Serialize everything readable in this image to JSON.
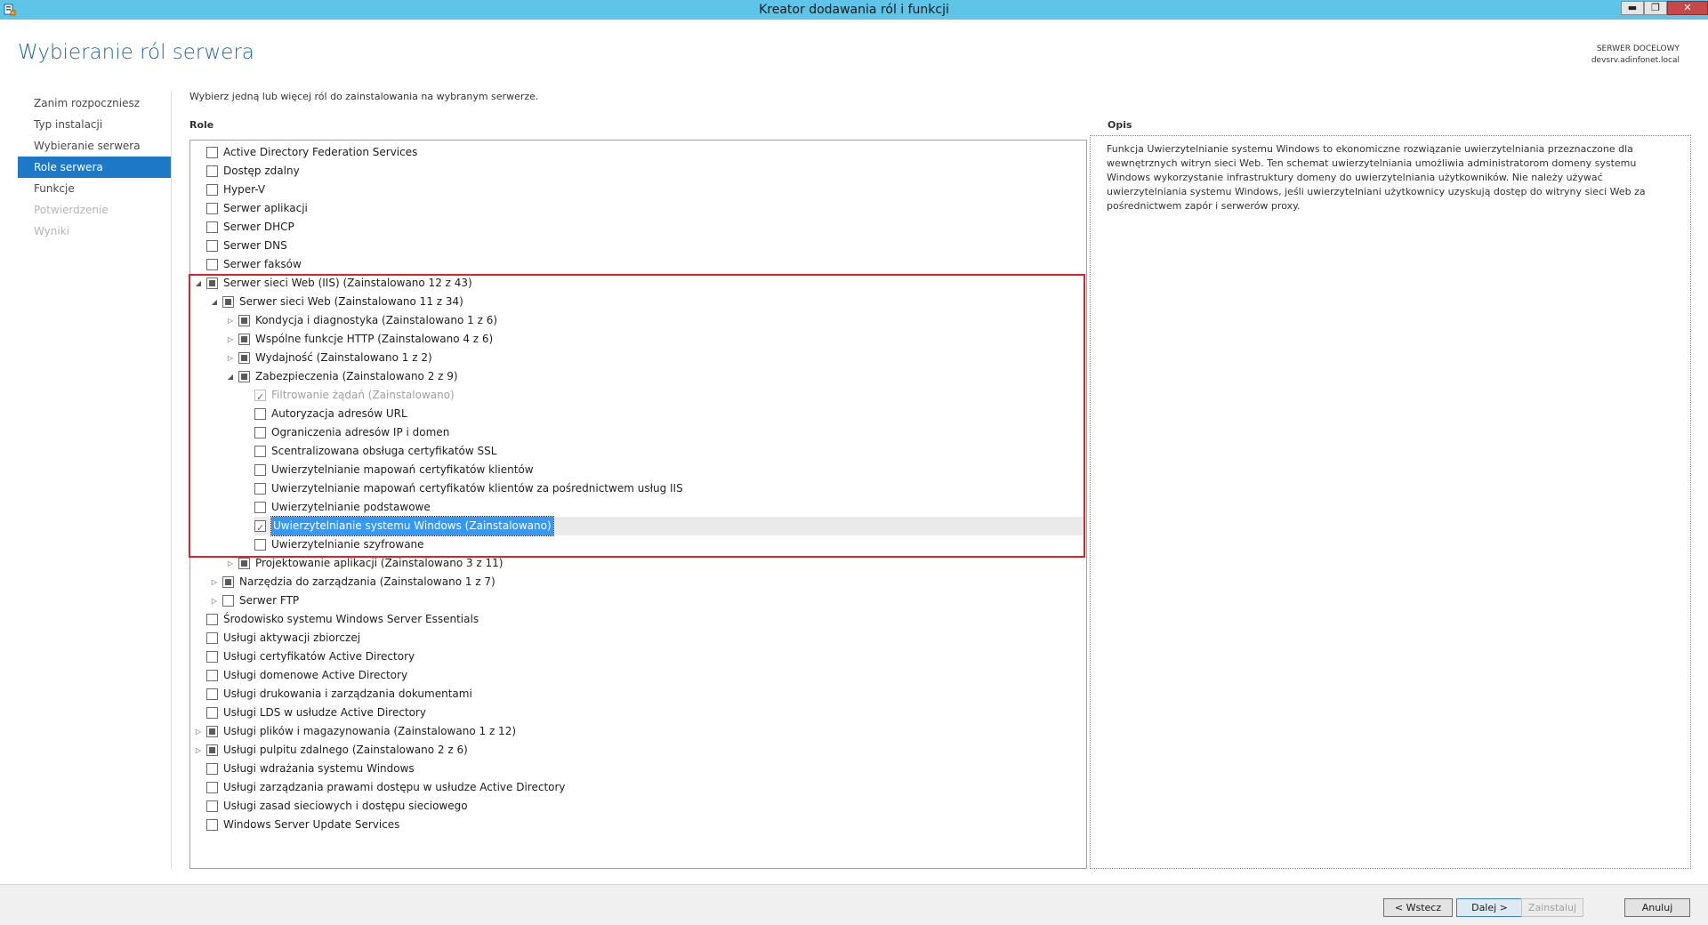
{
  "window": {
    "title": "Kreator dodawania ról i funkcji",
    "minimize_label": "▬",
    "maximize_label": "❐",
    "close_label": "✕"
  },
  "page": {
    "title": "Wybieranie ról serwera",
    "dest_label": "SERWER DOCELOWY",
    "dest_server": "devsrv.adinfonet.local"
  },
  "nav": {
    "items": [
      {
        "label": "Zanim rozpoczniesz",
        "state": "normal"
      },
      {
        "label": "Typ instalacji",
        "state": "normal"
      },
      {
        "label": "Wybieranie serwera",
        "state": "normal"
      },
      {
        "label": "Role serwera",
        "state": "active"
      },
      {
        "label": "Funkcje",
        "state": "normal"
      },
      {
        "label": "Potwierdzenie",
        "state": "disabled"
      },
      {
        "label": "Wyniki",
        "state": "disabled"
      }
    ]
  },
  "main": {
    "instructions": "Wybierz jedną lub więcej ról do zainstalowania na wybranym serwerze.",
    "roles_heading": "Role",
    "description_heading": "Opis",
    "description_text": "Funkcja Uwierzytelnianie systemu Windows to ekonomiczne rozwiązanie uwierzytelniania przeznaczone dla wewnętrznych witryn sieci Web. Ten schemat uwierzytelniania umożliwia administratorom domeny systemu Windows wykorzystanie infrastruktury domeny do uwierzytelniania użytkowników. Nie należy używać uwierzytelniania systemu Windows, jeśli uwierzytelniani użytkownicy uzyskują dostęp do witryny sieci Web za pośrednictwem zapór i serwerów proxy."
  },
  "roles": [
    {
      "label": "Active Directory Federation Services",
      "level": 0,
      "expander": "",
      "check": "unchecked"
    },
    {
      "label": "Dostęp zdalny",
      "level": 0,
      "expander": "",
      "check": "unchecked"
    },
    {
      "label": "Hyper-V",
      "level": 0,
      "expander": "",
      "check": "unchecked"
    },
    {
      "label": "Serwer aplikacji",
      "level": 0,
      "expander": "",
      "check": "unchecked"
    },
    {
      "label": "Serwer DHCP",
      "level": 0,
      "expander": "",
      "check": "unchecked"
    },
    {
      "label": "Serwer DNS",
      "level": 0,
      "expander": "",
      "check": "unchecked"
    },
    {
      "label": "Serwer faksów",
      "level": 0,
      "expander": "",
      "check": "unchecked"
    },
    {
      "label": "Serwer sieci Web (IIS) (Zainstalowano 12 z 43)",
      "level": 0,
      "expander": "◢",
      "check": "partial"
    },
    {
      "label": "Serwer sieci Web (Zainstalowano 11 z 34)",
      "level": 1,
      "expander": "◢",
      "check": "partial"
    },
    {
      "label": "Kondycja i diagnostyka (Zainstalowano 1 z 6)",
      "level": 2,
      "expander": "▷",
      "check": "partial"
    },
    {
      "label": "Wspólne funkcje HTTP (Zainstalowano 4 z 6)",
      "level": 2,
      "expander": "▷",
      "check": "partial"
    },
    {
      "label": "Wydajność (Zainstalowano 1 z 2)",
      "level": 2,
      "expander": "▷",
      "check": "partial"
    },
    {
      "label": "Zabezpieczenia (Zainstalowano 2 z 9)",
      "level": 2,
      "expander": "◢",
      "check": "partial"
    },
    {
      "label": "Filtrowanie żądań (Zainstalowano)",
      "level": 3,
      "expander": "",
      "check": "checked-disabled"
    },
    {
      "label": "Autoryzacja adresów URL",
      "level": 3,
      "expander": "",
      "check": "unchecked"
    },
    {
      "label": "Ograniczenia adresów IP i domen",
      "level": 3,
      "expander": "",
      "check": "unchecked"
    },
    {
      "label": "Scentralizowana obsługa certyfikatów SSL",
      "level": 3,
      "expander": "",
      "check": "unchecked"
    },
    {
      "label": "Uwierzytelnianie mapowań certyfikatów klientów",
      "level": 3,
      "expander": "",
      "check": "unchecked"
    },
    {
      "label": "Uwierzytelnianie mapowań certyfikatów klientów za pośrednictwem usług IIS",
      "level": 3,
      "expander": "",
      "check": "unchecked"
    },
    {
      "label": "Uwierzytelnianie podstawowe",
      "level": 3,
      "expander": "",
      "check": "unchecked"
    },
    {
      "label": "Uwierzytelnianie systemu Windows (Zainstalowano)",
      "level": 3,
      "expander": "",
      "check": "checked",
      "selected": true
    },
    {
      "label": "Uwierzytelnianie szyfrowane",
      "level": 3,
      "expander": "",
      "check": "unchecked"
    },
    {
      "label": "Projektowanie aplikacji (Zainstalowano 3 z 11)",
      "level": 2,
      "expander": "▷",
      "check": "partial"
    },
    {
      "label": "Narzędzia do zarządzania (Zainstalowano 1 z 7)",
      "level": 1,
      "expander": "▷",
      "check": "partial"
    },
    {
      "label": "Serwer FTP",
      "level": 1,
      "expander": "▷",
      "check": "unchecked"
    },
    {
      "label": "Środowisko systemu Windows Server Essentials",
      "level": 0,
      "expander": "",
      "check": "unchecked"
    },
    {
      "label": "Usługi aktywacji zbiorczej",
      "level": 0,
      "expander": "",
      "check": "unchecked"
    },
    {
      "label": "Usługi certyfikatów Active Directory",
      "level": 0,
      "expander": "",
      "check": "unchecked"
    },
    {
      "label": "Usługi domenowe Active Directory",
      "level": 0,
      "expander": "",
      "check": "unchecked"
    },
    {
      "label": "Usługi drukowania i zarządzania dokumentami",
      "level": 0,
      "expander": "",
      "check": "unchecked"
    },
    {
      "label": "Usługi LDS w usłudze Active Directory",
      "level": 0,
      "expander": "",
      "check": "unchecked"
    },
    {
      "label": "Usługi plików i magazynowania (Zainstalowano 1 z 12)",
      "level": 0,
      "expander": "▷",
      "check": "partial"
    },
    {
      "label": "Usługi pulpitu zdalnego (Zainstalowano 2 z 6)",
      "level": 0,
      "expander": "▷",
      "check": "partial"
    },
    {
      "label": "Usługi wdrażania systemu Windows",
      "level": 0,
      "expander": "",
      "check": "unchecked"
    },
    {
      "label": "Usługi zarządzania prawami dostępu w usłudze Active Directory",
      "level": 0,
      "expander": "",
      "check": "unchecked"
    },
    {
      "label": "Usługi zasad sieciowych i dostępu sieciowego",
      "level": 0,
      "expander": "",
      "check": "unchecked"
    },
    {
      "label": "Windows Server Update Services",
      "level": 0,
      "expander": "",
      "check": "unchecked"
    }
  ],
  "buttons": {
    "back": "< Wstecz",
    "next": "Dalej >",
    "install": "Zainstaluj",
    "cancel": "Anuluj"
  },
  "colors": {
    "titlebar": "#5ec4e8",
    "accent": "#1e78c8",
    "highlight_border": "#d9232e",
    "selection": "#3399ff"
  }
}
